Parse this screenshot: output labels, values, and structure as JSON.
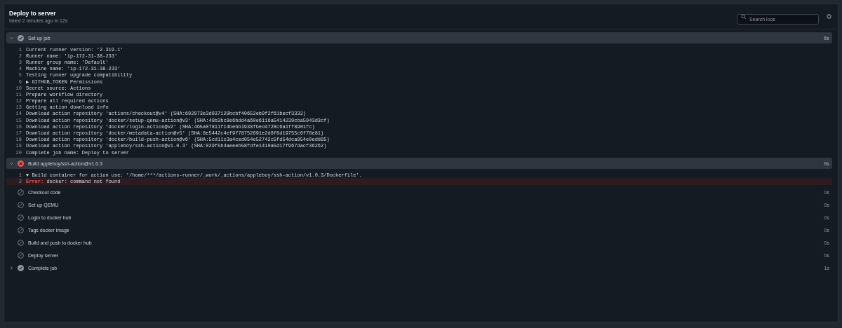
{
  "header": {
    "title": "Deploy to server",
    "subtitle": "failed 2 minutes ago in 12s"
  },
  "search": {
    "placeholder": "Search logs"
  },
  "steps": [
    {
      "name": "Set up job",
      "kind": "success",
      "expanded": true,
      "duration": "6s",
      "lines": [
        {
          "number": "1",
          "text": "Current runner version: '2.319.1'"
        },
        {
          "number": "2",
          "text": "Runner name: 'ip-172-31-38-233'"
        },
        {
          "number": "3",
          "text": "Runner group name: 'Default'"
        },
        {
          "number": "4",
          "text": "Machine name: 'ip-172-31-38-233'"
        },
        {
          "number": "5",
          "text": "Testing runner upgrade compatibility"
        },
        {
          "number": "6",
          "text": "▶ GITHUB_TOKEN Permissions"
        },
        {
          "number": "10",
          "text": "Secret source: Actions"
        },
        {
          "number": "11",
          "text": "Prepare workflow directory"
        },
        {
          "number": "12",
          "text": "Prepare all required actions"
        },
        {
          "number": "13",
          "text": "Getting action download info"
        },
        {
          "number": "14",
          "text": "Download action repository 'actions/checkout@v4' (SHA:692973e3d937129bcbf40652eb9f2f61becf3332)"
        },
        {
          "number": "15",
          "text": "Download action repository 'docker/setup-qemu-action@v3' (SHA:49b3bc8e6bdd4a60e6116a5414239cba5943d3cf)"
        },
        {
          "number": "16",
          "text": "Download action repository 'docker/login-action@v2' (SHA:465a07811f14bebb1938fbed4728c6a1ff8901fc)"
        },
        {
          "number": "17",
          "text": "Download action repository 'docker/metadata-action@v5' (SHA:8e5442c4ef9f78752691e2d8f8d19755c6f78e81)"
        },
        {
          "number": "18",
          "text": "Download action repository 'docker/build-push-action@v6' (SHA:5cd11c3a4ced054e52742c5fd54dca954e0edd85)"
        },
        {
          "number": "19",
          "text": "Download action repository 'appleboy/ssh-action@v1.0.3' (SHA:029f5b4aeeeb58fdfe1410a5d17f967dacf36262)"
        },
        {
          "number": "20",
          "text": "Complete job name: Deploy to server"
        }
      ]
    },
    {
      "name": "Build appleboy/ssh-action@v1.0.3",
      "kind": "failure",
      "expanded": true,
      "duration": "0s",
      "lines": [
        {
          "number": "1",
          "text": "▼ Build container for action use: '/home/***/actions-runner/_work/_actions/appleboy/ssh-action/v1.0.3/Dockerfile'."
        },
        {
          "number": "2",
          "kind": "error",
          "prefix": "Error:",
          "text": "docker: command not found"
        }
      ]
    },
    {
      "name": "Checkout code",
      "kind": "skipped",
      "expanded": false,
      "duration": "0s"
    },
    {
      "name": "Set up QEMU",
      "kind": "skipped",
      "expanded": false,
      "duration": "0s"
    },
    {
      "name": "Login to docker hub",
      "kind": "skipped",
      "expanded": false,
      "duration": "0s"
    },
    {
      "name": "Tags docker image",
      "kind": "skipped",
      "expanded": false,
      "duration": "0s"
    },
    {
      "name": "Build and push to docker hub",
      "kind": "skipped",
      "expanded": false,
      "duration": "0s"
    },
    {
      "name": "Deploy server",
      "kind": "skipped",
      "expanded": false,
      "duration": "0s"
    },
    {
      "name": "Complete job",
      "kind": "success",
      "expanded": false,
      "duration": "1s",
      "collapsible": true
    }
  ]
}
